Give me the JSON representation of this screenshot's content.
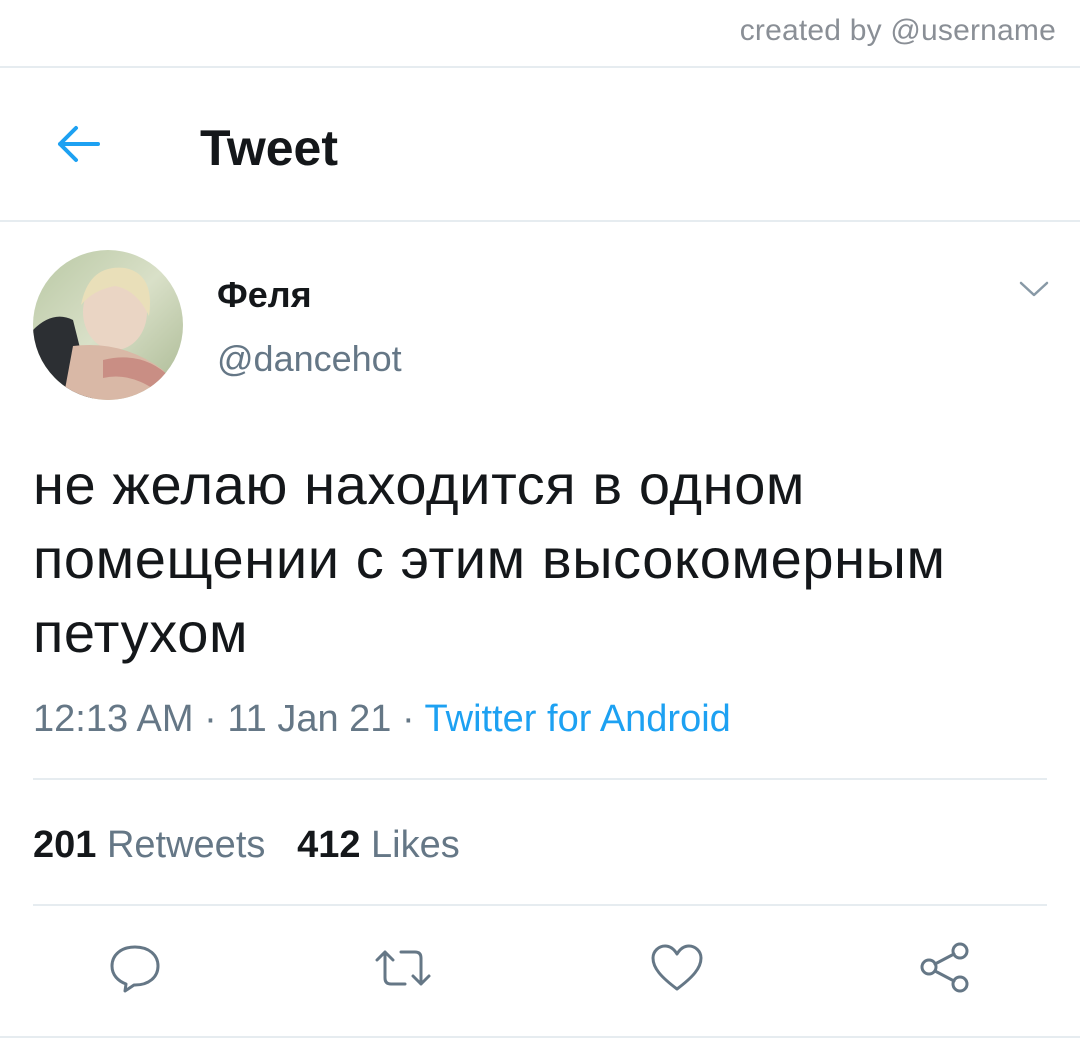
{
  "credit": "created by @username",
  "header": {
    "title": "Tweet",
    "back_icon": "arrow-left-icon",
    "accent_color": "#1da1f2"
  },
  "tweet": {
    "display_name": "Феля",
    "handle": "@dancehot",
    "text": "не желаю находится в одном\nпомещении с этим высокомерным\nпетухом",
    "time": "12:13 AM",
    "separator": " · ",
    "date": "11 Jan 21",
    "source": "Twitter for Android"
  },
  "stats": {
    "retweets_count": "201",
    "retweets_label": "Retweets",
    "likes_count": "412",
    "likes_label": "Likes"
  },
  "actions": [
    "reply-icon",
    "retweet-icon",
    "like-icon",
    "share-icon"
  ],
  "colors": {
    "text_primary": "#14171a",
    "text_secondary": "#657786",
    "divider": "#e6ecf0",
    "link": "#1da1f2"
  }
}
